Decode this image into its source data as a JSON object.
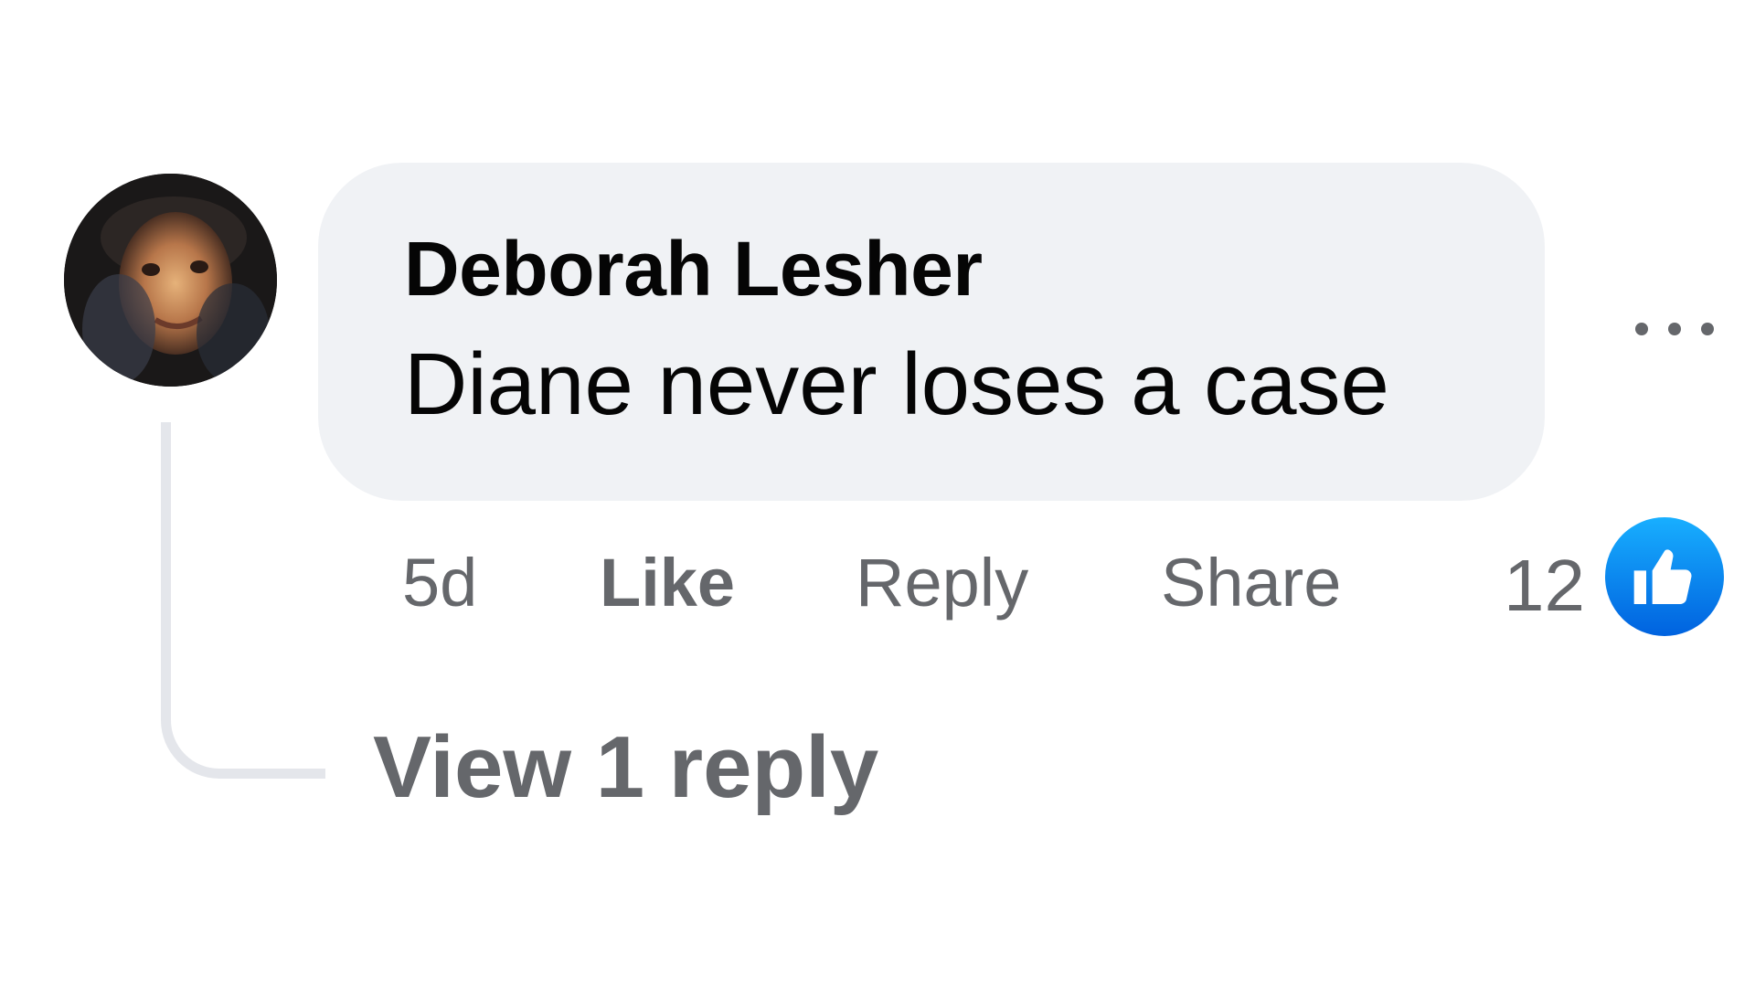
{
  "comment": {
    "author": "Deborah Lesher",
    "text": "Diane never loses a case",
    "avatar_icon": "profile-photo",
    "more_icon": "more-horizontal-icon"
  },
  "actions": {
    "timestamp": "5d",
    "like_label": "Like",
    "reply_label": "Reply",
    "share_label": "Share"
  },
  "reactions": {
    "count": "12",
    "icon": "thumbs-up-icon",
    "badge_color": "#0866ff"
  },
  "replies": {
    "view_label": "View 1 reply"
  }
}
